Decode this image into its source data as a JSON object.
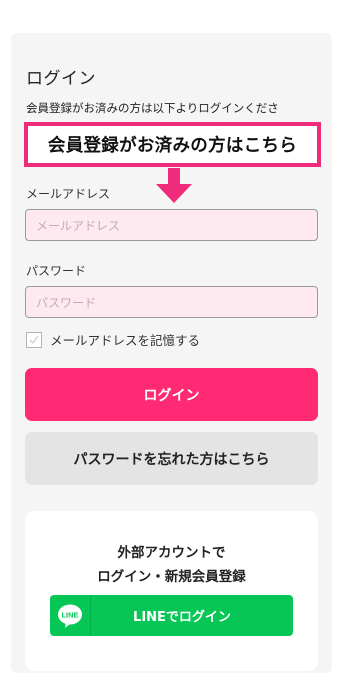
{
  "login": {
    "title": "ログイン",
    "notice": "会員登録がお済みの方は以下よりログインくださ",
    "callout": "会員登録がお済みの方はこちら",
    "email_label": "メールアドレス",
    "email_placeholder": "メールアドレス",
    "password_label": "パスワード",
    "password_placeholder": "パスワード",
    "remember_label": "メールアドレスを記憶する",
    "login_button": "ログイン",
    "forgot_button": "パスワードを忘れた方はこちら"
  },
  "social": {
    "heading_line1": "外部アカウントで",
    "heading_line2": "ログイン・新規会員登録",
    "line_icon_text": "LINE",
    "line_button": "LINEでログイン"
  },
  "colors": {
    "accent": "#ff2a73",
    "callout_border": "#ef2c7b",
    "line_green": "#06c755",
    "field_bg": "#fde9ef"
  }
}
